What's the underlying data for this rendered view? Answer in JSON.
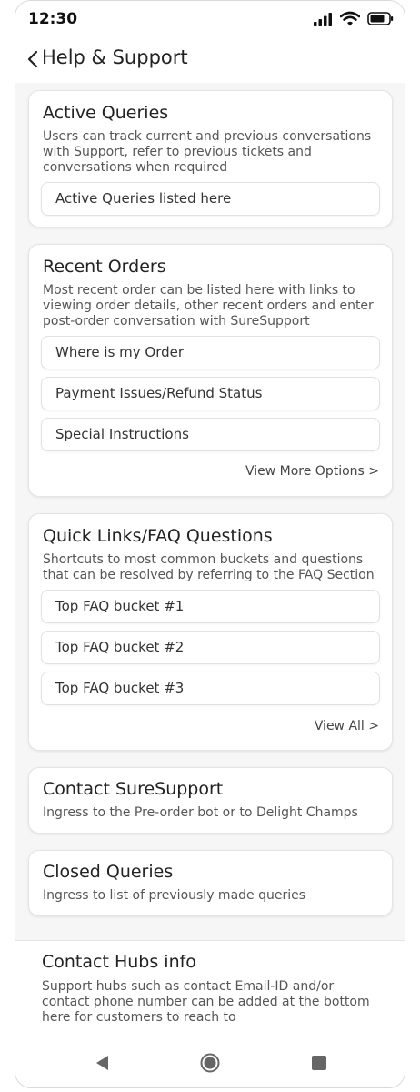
{
  "status": {
    "time": "12:30"
  },
  "header": {
    "title": "Help & Support"
  },
  "active_queries": {
    "title": "Active Queries",
    "description": "Users can track current and previous conversations with Support, refer to previous tickets and conversations when required",
    "items": [
      "Active Queries listed here"
    ]
  },
  "recent_orders": {
    "title": "Recent Orders",
    "description": "Most recent order can be listed here with links to viewing order details, other recent orders and enter post-order conversation with SureSupport",
    "items": [
      "Where is my Order",
      "Payment Issues/Refund Status",
      "Special Instructions"
    ],
    "more_label": "View More Options >"
  },
  "quick_links": {
    "title": "Quick Links/FAQ Questions",
    "description": "Shortcuts to most common buckets and questions that can be resolved by referring to the FAQ Section",
    "items": [
      "Top FAQ bucket #1",
      "Top FAQ bucket #2",
      "Top FAQ bucket #3"
    ],
    "more_label": "View All >"
  },
  "contact_support": {
    "title": "Contact SureSupport",
    "description": "Ingress to the Pre-order bot or to Delight Champs"
  },
  "closed_queries": {
    "title": "Closed Queries",
    "description": "Ingress to list of previously made queries"
  },
  "contact_hubs": {
    "title": "Contact Hubs info",
    "description": "Support hubs such as contact Email-ID and/or contact phone number can be added at the bottom here for customers to reach to"
  },
  "icons": {
    "back": "chevron-left-icon",
    "signal": "signal-icon",
    "wifi": "wifi-icon",
    "battery": "battery-icon",
    "nav_back": "triangle-back-icon",
    "nav_home": "circle-home-icon",
    "nav_recents": "square-recents-icon"
  }
}
